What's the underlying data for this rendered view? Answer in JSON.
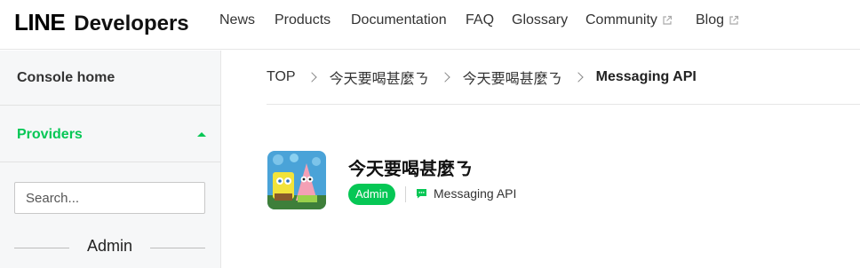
{
  "header": {
    "logo_line": "LINE",
    "logo_developers": "Developers",
    "nav": [
      {
        "label": "News",
        "external": false
      },
      {
        "label": "Products",
        "external": false
      },
      {
        "label": "Documentation",
        "external": false
      },
      {
        "label": "FAQ",
        "external": false
      },
      {
        "label": "Glossary",
        "external": false
      },
      {
        "label": "Community",
        "external": true,
        "icon": "external-link-icon"
      },
      {
        "label": "Blog",
        "external": true,
        "icon": "external-link-icon"
      }
    ]
  },
  "sidebar": {
    "console_home": "Console home",
    "providers": "Providers",
    "providers_icon": "caret-up-icon",
    "search_placeholder": "Search...",
    "section_label": "Admin"
  },
  "breadcrumb": {
    "items": [
      "TOP",
      "今天要喝甚麼ㄋ",
      "今天要喝甚麼ㄋ",
      "Messaging API"
    ]
  },
  "channel": {
    "name": "今天要喝甚麼ㄋ",
    "role_badge": "Admin",
    "type_icon": "chat-bubble-icon",
    "type_label": "Messaging API"
  },
  "colors": {
    "brand_green": "#06c755",
    "sidebar_bg": "#f6f7f8",
    "divider": "#e6e6e6"
  }
}
